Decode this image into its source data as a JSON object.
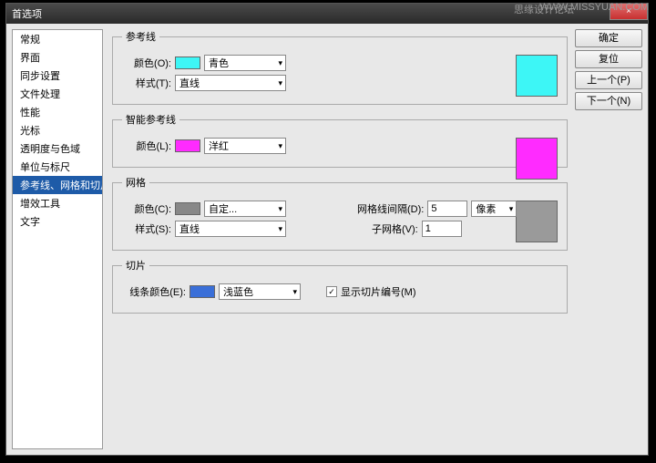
{
  "watermark1": "思缘设计论坛",
  "watermark2": "WWW.MISSYUAN.COM",
  "title": "首选项",
  "close": "×",
  "sidebar": {
    "items": [
      {
        "label": "常规"
      },
      {
        "label": "界面"
      },
      {
        "label": "同步设置"
      },
      {
        "label": "文件处理"
      },
      {
        "label": "性能"
      },
      {
        "label": "光标"
      },
      {
        "label": "透明度与色域"
      },
      {
        "label": "单位与标尺"
      },
      {
        "label": "参考线、网格和切片"
      },
      {
        "label": "增效工具"
      },
      {
        "label": "文字"
      }
    ]
  },
  "buttons": {
    "ok": "确定",
    "cancel": "复位",
    "prev": "上一个(P)",
    "next": "下一个(N)"
  },
  "guides": {
    "legend": "参考线",
    "color_label": "颜色(O):",
    "color_value": "青色",
    "color_hex": "#3df6f6",
    "style_label": "样式(T):",
    "style_value": "直线",
    "swatch": "#3df6f6"
  },
  "smart": {
    "legend": "智能参考线",
    "color_label": "颜色(L):",
    "color_value": "洋红",
    "color_hex": "#ff2bff",
    "swatch": "#ff2bff"
  },
  "grid": {
    "legend": "网格",
    "color_label": "颜色(C):",
    "color_value": "自定...",
    "color_hex": "#888888",
    "style_label": "样式(S):",
    "style_value": "直线",
    "spacing_label": "网格线间隔(D):",
    "spacing_value": "5",
    "spacing_unit": "像素",
    "sub_label": "子网格(V):",
    "sub_value": "1",
    "swatch": "#9a9a9a"
  },
  "slice": {
    "legend": "切片",
    "color_label": "线条颜色(E):",
    "color_value": "浅蓝色",
    "color_hex": "#3a6fd8",
    "checkbox_label": "显示切片编号(M)",
    "checked": true
  }
}
